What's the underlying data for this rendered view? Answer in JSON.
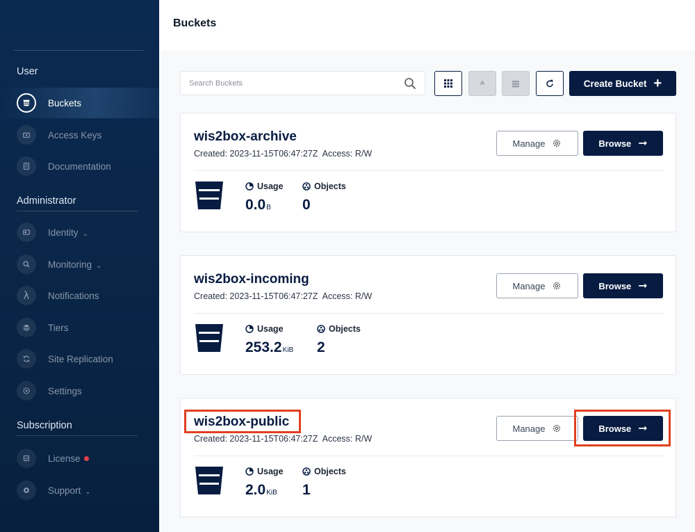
{
  "sidebar": {
    "sections": {
      "user": "User",
      "administrator": "Administrator",
      "subscription": "Subscription"
    },
    "items": [
      {
        "key": "buckets",
        "label": "Buckets",
        "icon": "bucket-icon",
        "active": true
      },
      {
        "key": "access-keys",
        "label": "Access Keys",
        "icon": "key-icon"
      },
      {
        "key": "documentation",
        "label": "Documentation",
        "icon": "document-icon"
      },
      {
        "key": "identity",
        "label": "Identity",
        "icon": "id-card-icon",
        "chevron": true
      },
      {
        "key": "monitoring",
        "label": "Monitoring",
        "icon": "magnifier-icon",
        "chevron": true
      },
      {
        "key": "notifications",
        "label": "Notifications",
        "icon": "lambda-icon"
      },
      {
        "key": "tiers",
        "label": "Tiers",
        "icon": "layers-icon"
      },
      {
        "key": "site-replication",
        "label": "Site Replication",
        "icon": "sync-icon"
      },
      {
        "key": "settings",
        "label": "Settings",
        "icon": "gear-icon"
      },
      {
        "key": "license",
        "label": "License",
        "icon": "license-icon",
        "badge_dot": true
      },
      {
        "key": "support",
        "label": "Support",
        "icon": "support-icon",
        "chevron": true
      }
    ]
  },
  "header": {
    "title": "Buckets"
  },
  "toolbar": {
    "search_placeholder": "Search Buckets",
    "create_label": "Create Bucket",
    "create_icon": "+"
  },
  "buckets": [
    {
      "name": "wis2box-archive",
      "created_label": "Created: 2023-11-15T06:47:27Z",
      "access_label": "Access: R/W",
      "usage_label": "Usage",
      "usage_value": "0.0",
      "usage_unit": "B",
      "objects_label": "Objects",
      "objects_value": "0",
      "manage_label": "Manage",
      "browse_label": "Browse"
    },
    {
      "name": "wis2box-incoming",
      "created_label": "Created: 2023-11-15T06:47:27Z",
      "access_label": "Access: R/W",
      "usage_label": "Usage",
      "usage_value": "253.2",
      "usage_unit": "KiB",
      "objects_label": "Objects",
      "objects_value": "2",
      "manage_label": "Manage",
      "browse_label": "Browse"
    },
    {
      "name": "wis2box-public",
      "created_label": "Created: 2023-11-15T06:47:27Z",
      "access_label": "Access: R/W",
      "usage_label": "Usage",
      "usage_value": "2.0",
      "usage_unit": "KiB",
      "objects_label": "Objects",
      "objects_value": "1",
      "manage_label": "Manage",
      "browse_label": "Browse"
    }
  ],
  "colors": {
    "navy": "#081c42",
    "sidebar": "#0a2648",
    "highlight": "#e0401f",
    "license_dot": "#e0424a"
  }
}
